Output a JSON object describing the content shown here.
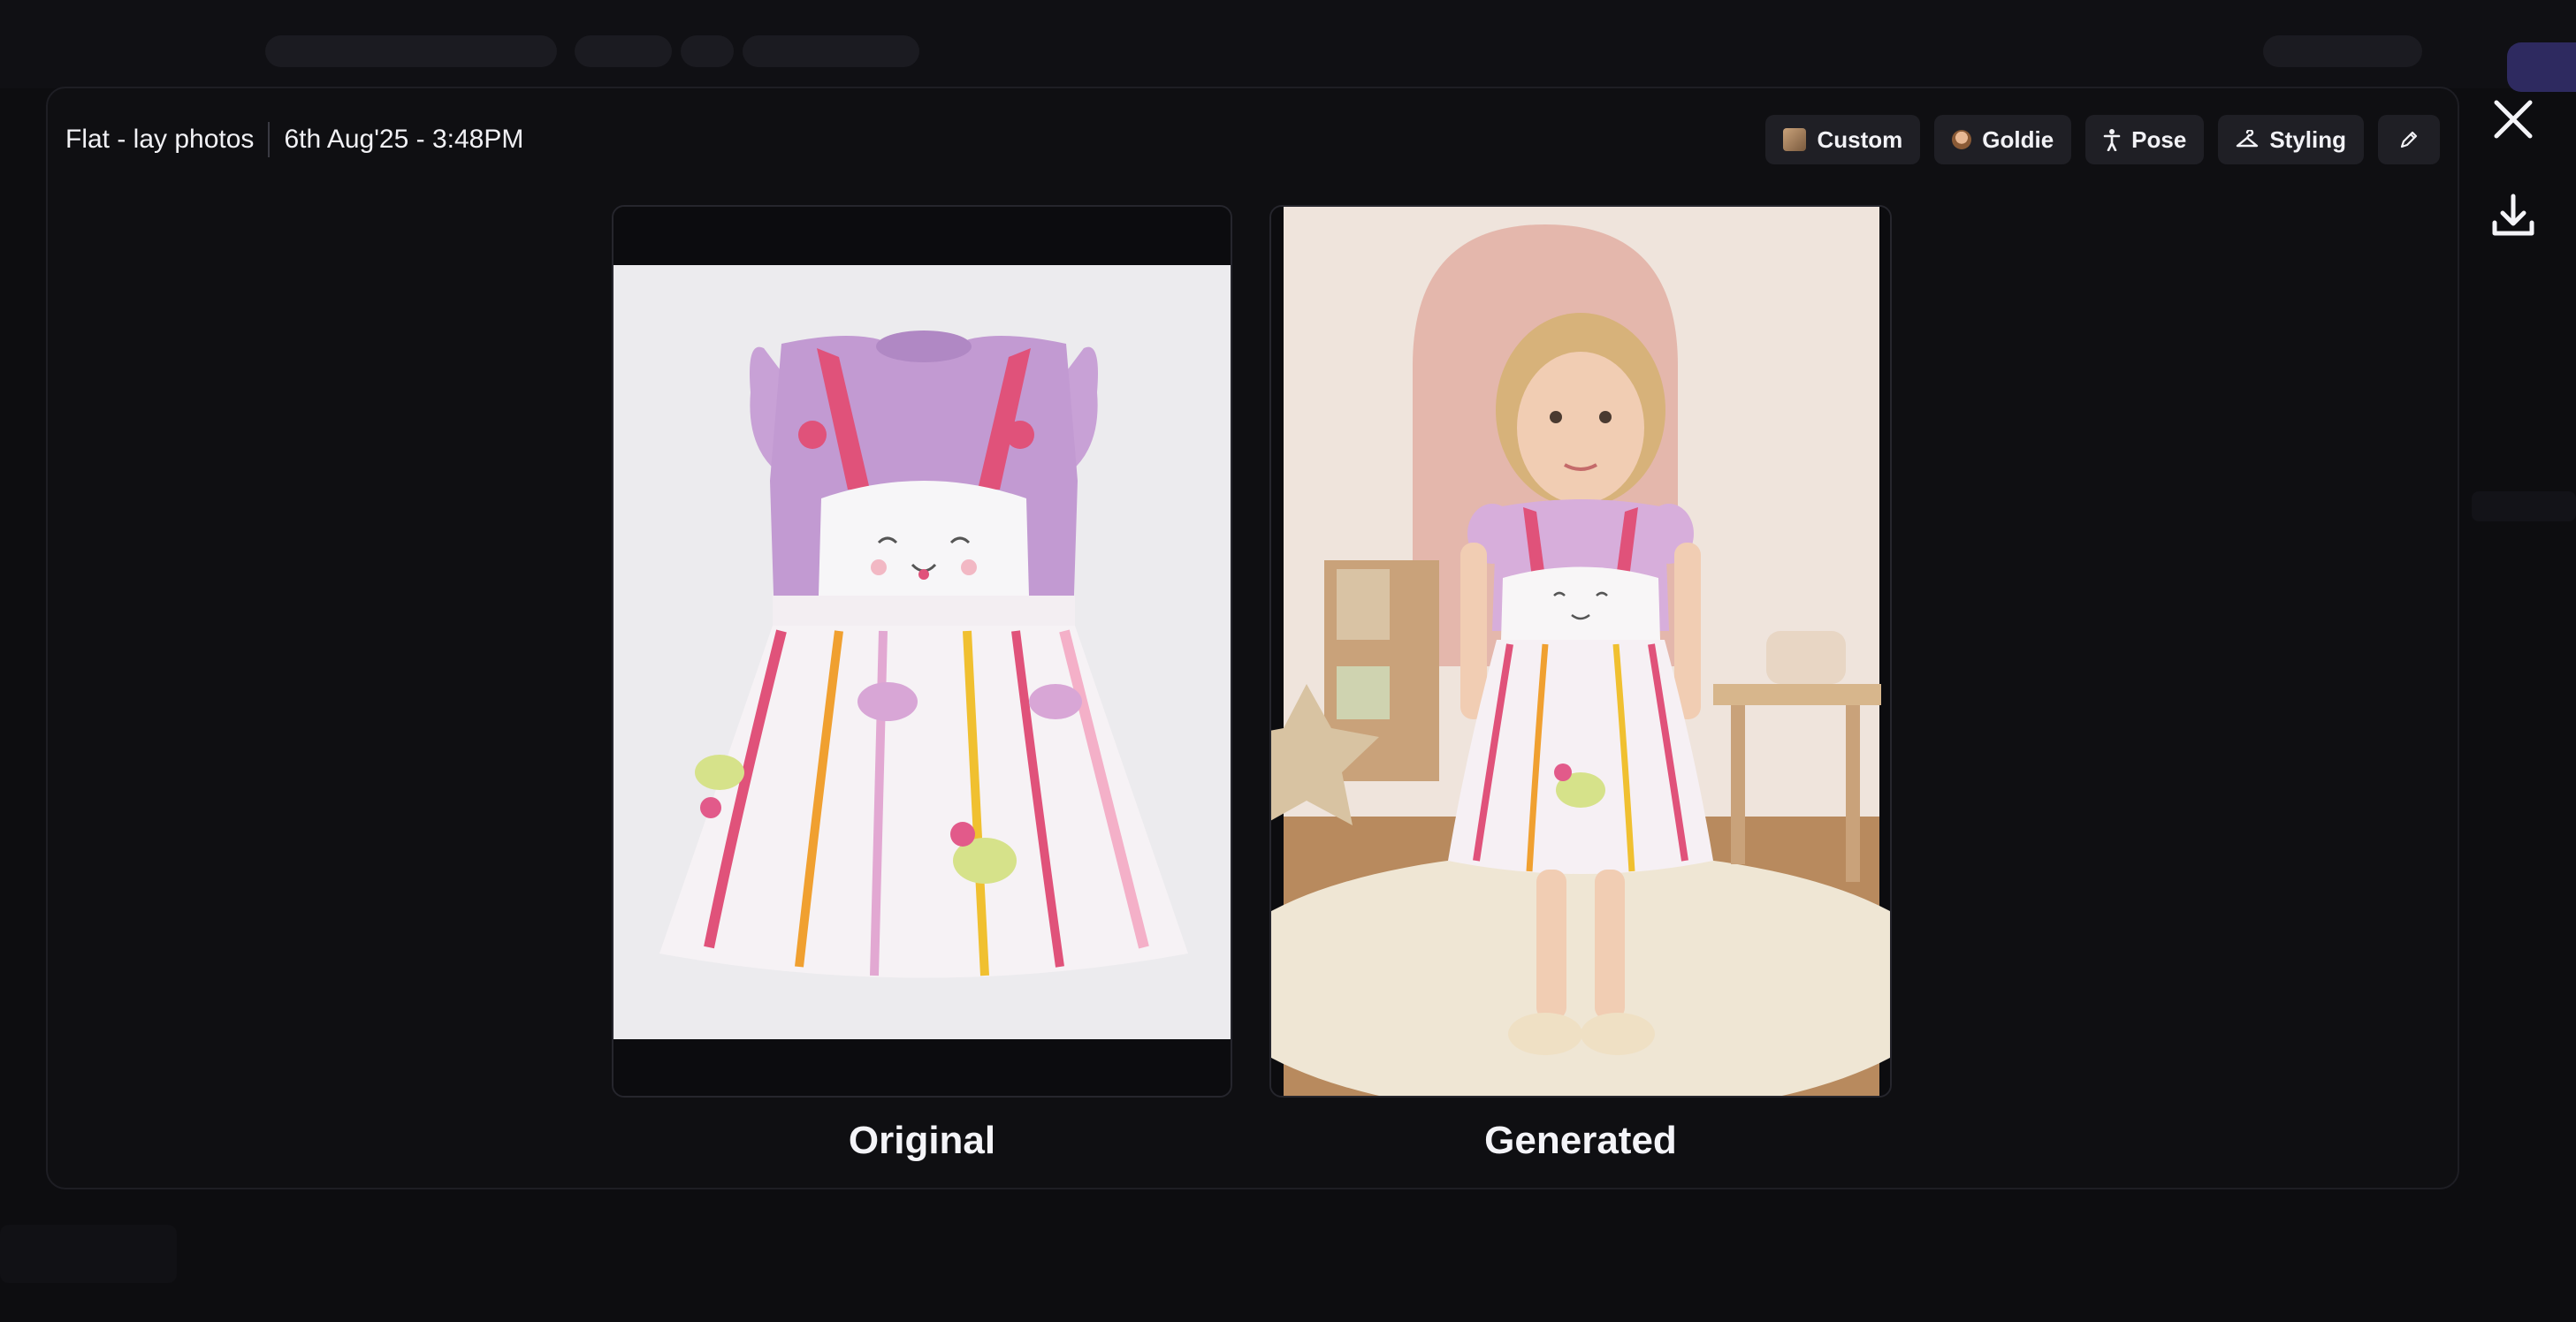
{
  "modal": {
    "title": "Flat - lay photos",
    "timestamp": "6th Aug'25 - 3:48PM",
    "chips": [
      {
        "label": "Custom",
        "icon": "image-thumbnail-icon"
      },
      {
        "label": "Goldie",
        "icon": "model-avatar-icon"
      },
      {
        "label": "Pose",
        "icon": "pose-figure-icon"
      },
      {
        "label": "Styling",
        "icon": "hanger-icon"
      }
    ],
    "edit_icon": "pencil-icon",
    "close_icon": "close-icon",
    "download_icon": "download-icon"
  },
  "images": {
    "original": {
      "caption": "Original"
    },
    "generated": {
      "caption": "Generated"
    }
  },
  "colors": {
    "background": "#0b0b0d",
    "modal": "#0f0f12",
    "chip": "#1f1f25",
    "accent": "#2e2a60",
    "dress_pink": "#e0527a",
    "shirt_lilac": "#c29ad2"
  }
}
